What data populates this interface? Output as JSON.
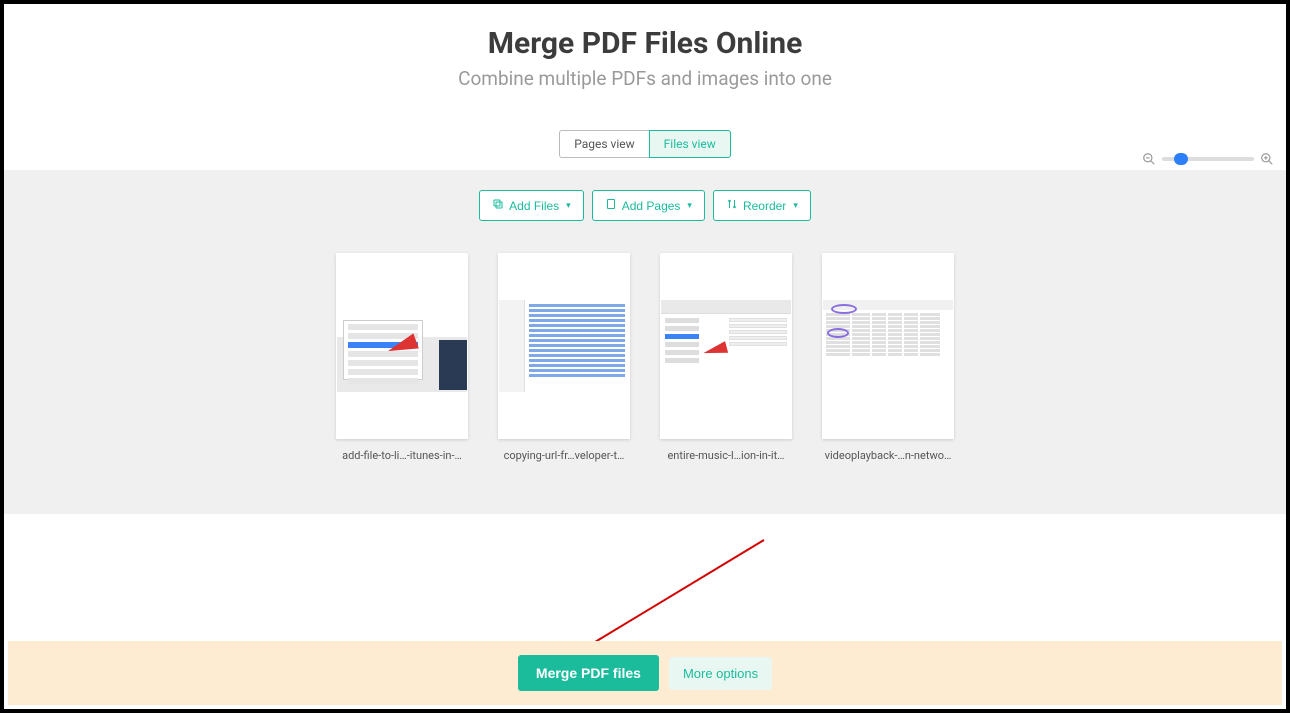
{
  "header": {
    "title": "Merge PDF Files Online",
    "subtitle": "Combine multiple PDFs and images into one"
  },
  "view_tabs": {
    "pages": "Pages view",
    "files": "Files view",
    "active": "files"
  },
  "toolbar": {
    "add_files": "Add Files",
    "add_pages": "Add Pages",
    "reorder": "Reorder"
  },
  "files": [
    {
      "label": "add-file-to-li…-itunes-in-…"
    },
    {
      "label": "copying-url-fr…veloper-t…"
    },
    {
      "label": "entire-music-l…ion-in-it…"
    },
    {
      "label": "videoplayback-…n-netwo…"
    }
  ],
  "footer": {
    "merge": "Merge PDF files",
    "more": "More options"
  }
}
